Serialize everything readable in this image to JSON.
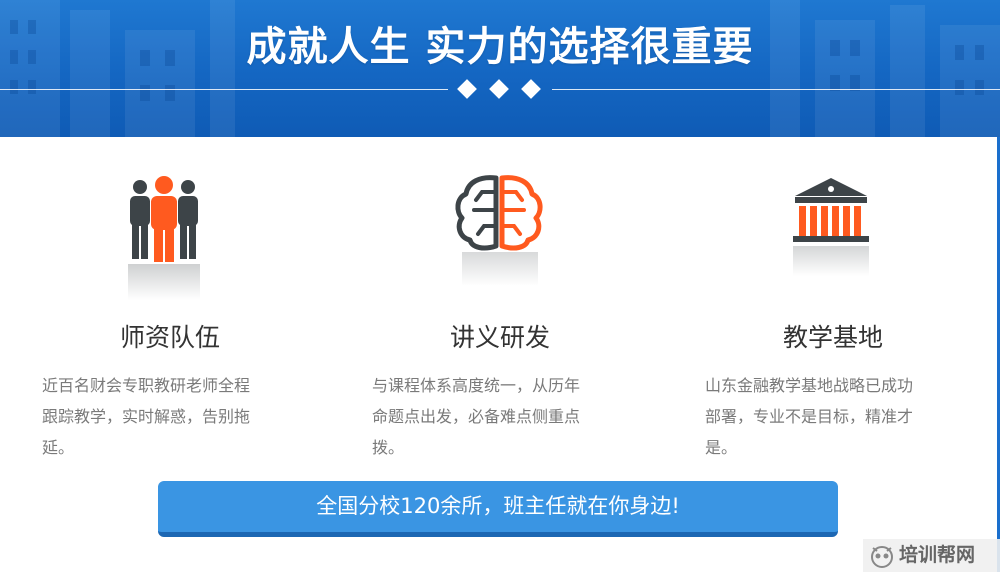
{
  "banner": {
    "title": "成就人生 实力的选择很重要"
  },
  "features": [
    {
      "icon": "team-icon",
      "title": "师资队伍",
      "desc_lines": [
        "近百名财会专职教研老师全程",
        "跟踪教学，实时解惑，告别拖",
        "延。"
      ]
    },
    {
      "icon": "brain-icon",
      "title": "讲义研发",
      "desc_lines": [
        "与课程体系高度统一，从历年",
        "命题点出发，必备难点侧重点",
        "拨。"
      ]
    },
    {
      "icon": "institution-building-icon",
      "title": "教学基地",
      "desc_lines": [
        "山东金融教学基地战略已成功",
        "部署，专业不是目标，精准才",
        "是。"
      ]
    }
  ],
  "cta": {
    "label": "全国分校120余所，班主任就在你身边!"
  },
  "watermark": {
    "text": "培训帮网"
  },
  "colors": {
    "banner_blue": "#1466c2",
    "accent_orange": "#ff5a1f",
    "icon_dark": "#3d4448",
    "cta_blue": "#3a95e3",
    "cta_shadow": "#1c67b3",
    "desc_gray": "#7a7a7a"
  }
}
